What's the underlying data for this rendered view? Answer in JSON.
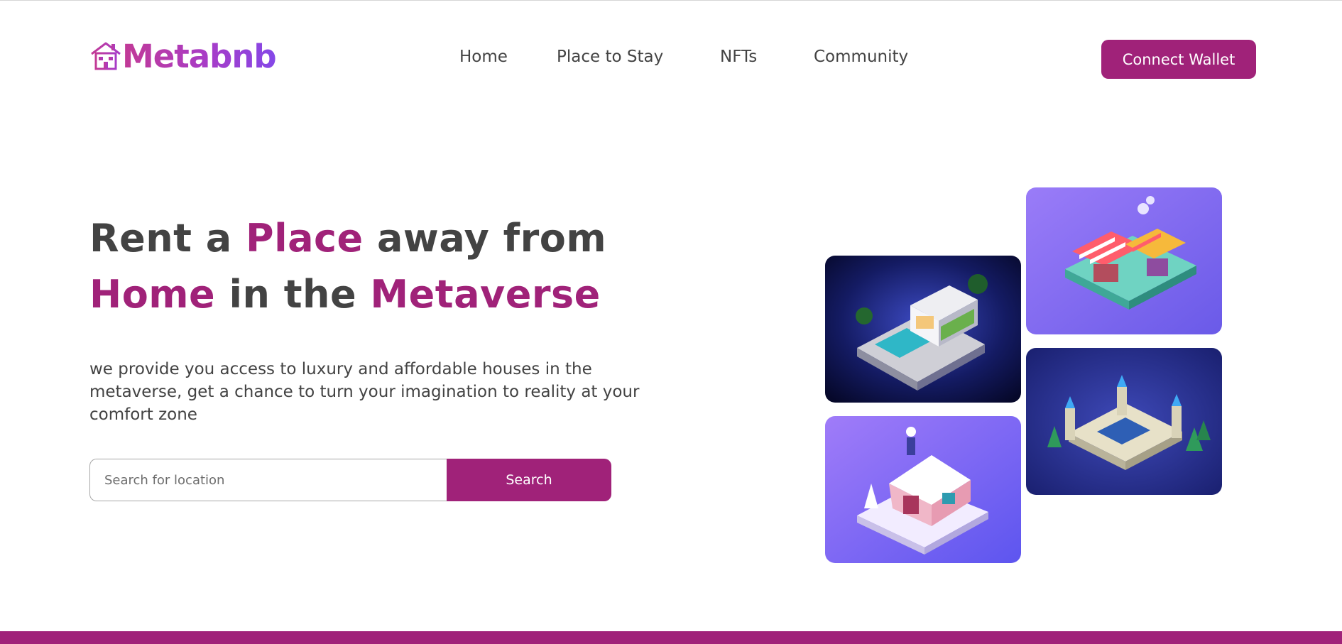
{
  "brand": {
    "name": "Metabnb",
    "gradient": [
      "#c23a95",
      "#8448e8"
    ]
  },
  "nav": {
    "items": [
      {
        "label": "Home"
      },
      {
        "label": "Place to Stay"
      },
      {
        "label": "NFTs"
      },
      {
        "label": "Community"
      }
    ]
  },
  "header": {
    "connect_label": "Connect Wallet"
  },
  "hero": {
    "headline": {
      "line1": {
        "part1": "Rent a ",
        "accent": "Place",
        "part2": " away from"
      },
      "line2": {
        "accent1": "Home",
        "mid": " in the ",
        "accent2": "Metaverse"
      }
    },
    "subtext": "we provide you access to luxury and affordable houses in the metaverse, get a chance to turn your imagination to reality at your comfort zone",
    "search": {
      "placeholder": "Search for location",
      "button_label": "Search"
    }
  },
  "gallery": [
    {
      "name": "modern-villa-image",
      "scene": "villa"
    },
    {
      "name": "market-stall-image",
      "scene": "market"
    },
    {
      "name": "castle-image",
      "scene": "castle"
    },
    {
      "name": "snow-cottage-image",
      "scene": "cottage"
    }
  ],
  "colors": {
    "accent": "#a02279",
    "text": "#434343",
    "card_dark": "#1c2270",
    "card_purple": "#7b5cf2"
  }
}
